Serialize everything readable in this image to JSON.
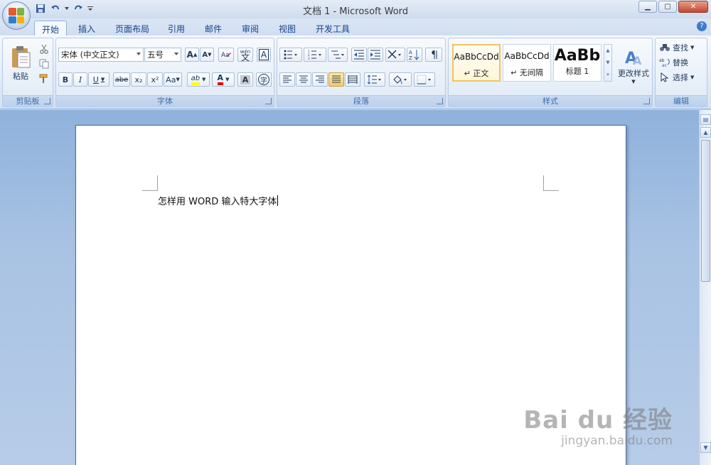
{
  "window": {
    "title": "文档 1 - Microsoft Word"
  },
  "tabs": [
    "开始",
    "插入",
    "页面布局",
    "引用",
    "邮件",
    "审阅",
    "视图",
    "开发工具"
  ],
  "active_tab": "开始",
  "ribbon": {
    "clipboard": {
      "label": "剪贴板",
      "paste_label": "粘贴"
    },
    "font": {
      "label": "字体",
      "font_name": "宋体 (中文正文)",
      "font_size": "五号",
      "grow": "A",
      "shrink": "A",
      "phonetic": "wén",
      "bold": "B",
      "italic": "I",
      "underline": "U",
      "strike": "abe",
      "subscript": "x₂",
      "superscript": "x²",
      "change_case": "Aa",
      "highlight": "ab",
      "font_color": "A",
      "char_shading": "A",
      "enclose": "字",
      "border_char": "A"
    },
    "paragraph": {
      "label": "段落"
    },
    "styles": {
      "label": "样式",
      "items": [
        {
          "sample": "AaBbCcDd",
          "name": "↵ 正文"
        },
        {
          "sample": "AaBbCcDd",
          "name": "↵ 无间隔"
        },
        {
          "sample": "AaBb",
          "name": "标题 1"
        }
      ],
      "change_styles": "更改样式"
    },
    "editing": {
      "label": "编辑",
      "find": "查找",
      "replace": "替换",
      "select": "选择"
    }
  },
  "document": {
    "text": "怎样用 WORD 输入特大字体"
  },
  "watermark": {
    "main": "Bai du 经验",
    "sub": "jingyan.baidu.com"
  },
  "colors": {
    "accent": "#15428b",
    "highlight": "#ffff00",
    "font_color": "#e00000"
  }
}
